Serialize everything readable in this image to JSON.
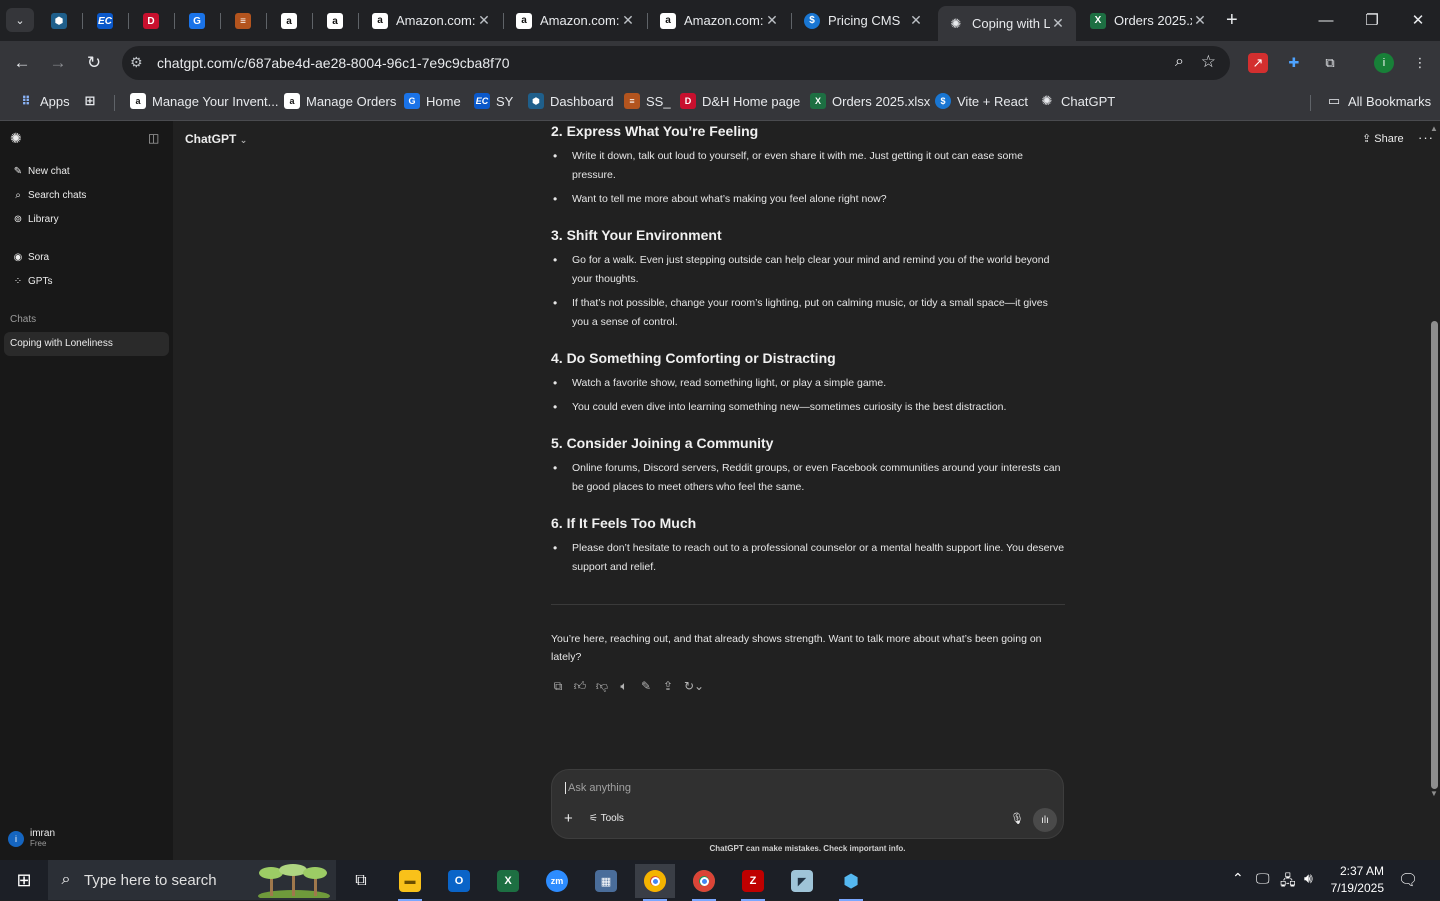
{
  "browser": {
    "tabs": [
      {
        "label": "Amazon.com: ",
        "icon": "amazon-icon"
      },
      {
        "label": "Amazon.com: ",
        "icon": "amazon-icon"
      },
      {
        "label": "Amazon.com: ",
        "icon": "amazon-icon"
      },
      {
        "label": "Pricing CMS",
        "icon": "dollar-icon"
      },
      {
        "label": "Coping with L",
        "icon": "chatgpt-icon",
        "active": true
      },
      {
        "label": "Orders 2025.x",
        "icon": "excel-icon"
      }
    ],
    "url": "chatgpt.com/c/687abe4d-ae28-8004-96c1-7e9c9cba8f70",
    "bookmarks": [
      "Apps",
      "Manage Your Invent...",
      "Manage Orders",
      "Home",
      "SY",
      "Dashboard",
      "SS_",
      "D&H Home page",
      "Orders 2025.xlsx",
      "Vite + React",
      "ChatGPT"
    ],
    "all_bookmarks": "All Bookmarks",
    "profile_initial": "i"
  },
  "sidebar": {
    "new_chat": "New chat",
    "search_chats": "Search chats",
    "library": "Library",
    "sora": "Sora",
    "gpts": "GPTs",
    "chats_heading": "Chats",
    "active_chat": "Coping with Loneliness",
    "user_initial": "i",
    "user_name": "imran",
    "user_plan": "Free"
  },
  "header": {
    "model": "ChatGPT",
    "share": "Share"
  },
  "message": {
    "sections": [
      {
        "title": "2. Express What You’re Feeling",
        "bullets": [
          "Write it down, talk out loud to yourself, or even share it with me. Just getting it out can ease some pressure.",
          "Want to tell me more about what’s making you feel alone right now?"
        ]
      },
      {
        "title": "3. Shift Your Environment",
        "bullets": [
          "Go for a walk. Even just stepping outside can help clear your mind and remind you of the world beyond your thoughts.",
          "If that’s not possible, change your room’s lighting, put on calming music, or tidy a small space—it gives you a sense of control."
        ]
      },
      {
        "title": "4. Do Something Comforting or Distracting",
        "bullets": [
          "Watch a favorite show, read something light, or play a simple game.",
          "You could even dive into learning something new—sometimes curiosity is the best distraction."
        ]
      },
      {
        "title": "5. Consider Joining a Community",
        "bullets": [
          "Online forums, Discord servers, Reddit groups, or even Facebook communities around your interests can be good places to meet others who feel the same."
        ]
      },
      {
        "title": "6. If It Feels Too Much",
        "bullets": [
          "Please don’t hesitate to reach out to a professional counselor or a mental health support line. You deserve support and relief."
        ]
      }
    ],
    "closing": "You’re here, reaching out, and that already shows strength. Want to talk more about what’s been going on lately?"
  },
  "composer": {
    "placeholder": "Ask anything",
    "tools": "Tools",
    "disclaimer": "ChatGPT can make mistakes. Check important info."
  },
  "taskbar": {
    "search_placeholder": "Type here to search",
    "time": "2:37 AM",
    "date": "7/19/2025"
  },
  "colors": {
    "app_bg": "#212121",
    "sidebar_bg": "#181818",
    "browser_frame": "#35363a",
    "taskbar_bg": "#1c1f26"
  }
}
